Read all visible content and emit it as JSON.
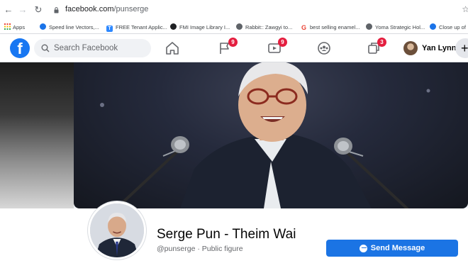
{
  "browser": {
    "url_host": "facebook.com",
    "url_path": "/punserge",
    "icons": [
      "back-arrow-icon",
      "forward-arrow-icon",
      "reload-icon",
      "lock-icon",
      "star-icon"
    ]
  },
  "bookmarks": [
    {
      "label": "Apps",
      "icon": "apps-grid-icon",
      "color": "#ea4335"
    },
    {
      "label": "Speed line Vectors,...",
      "icon": "bookmark-favicon",
      "color": "#1a73e8"
    },
    {
      "label": "FREE Tenant Applic...",
      "icon": "bookmark-favicon",
      "color": "#1a73e8"
    },
    {
      "label": "FMI Image Library I...",
      "icon": "bookmark-favicon",
      "color": "#202124"
    },
    {
      "label": "Rabbit:: Zawgyi to...",
      "icon": "globe-icon",
      "color": "#5f6368"
    },
    {
      "label": "best selling enamel...",
      "icon": "google-icon",
      "color": "#ea4335"
    },
    {
      "label": "Yoma Strategic Hol...",
      "icon": "globe-icon",
      "color": "#5f6368"
    },
    {
      "label": "Close up of",
      "icon": "bookmark-favicon",
      "color": "#1a73e8"
    }
  ],
  "header": {
    "logo_letter": "f",
    "search_placeholder": "Search Facebook",
    "nav": [
      {
        "name": "home",
        "badge": ""
      },
      {
        "name": "pages",
        "badge": "9"
      },
      {
        "name": "watch",
        "badge": "9"
      },
      {
        "name": "groups",
        "badge": ""
      },
      {
        "name": "gaming",
        "badge": "3"
      }
    ],
    "user_name": "Yan Lynn",
    "plus_label": "+",
    "accent": "#1877f2",
    "badge_color": "#e41e3f"
  },
  "profile": {
    "name": "Serge Pun - Theim Wai",
    "handle_line": "@punserge · Public figure",
    "send_message_label": "Send Message",
    "button_color": "#1b74e4"
  }
}
